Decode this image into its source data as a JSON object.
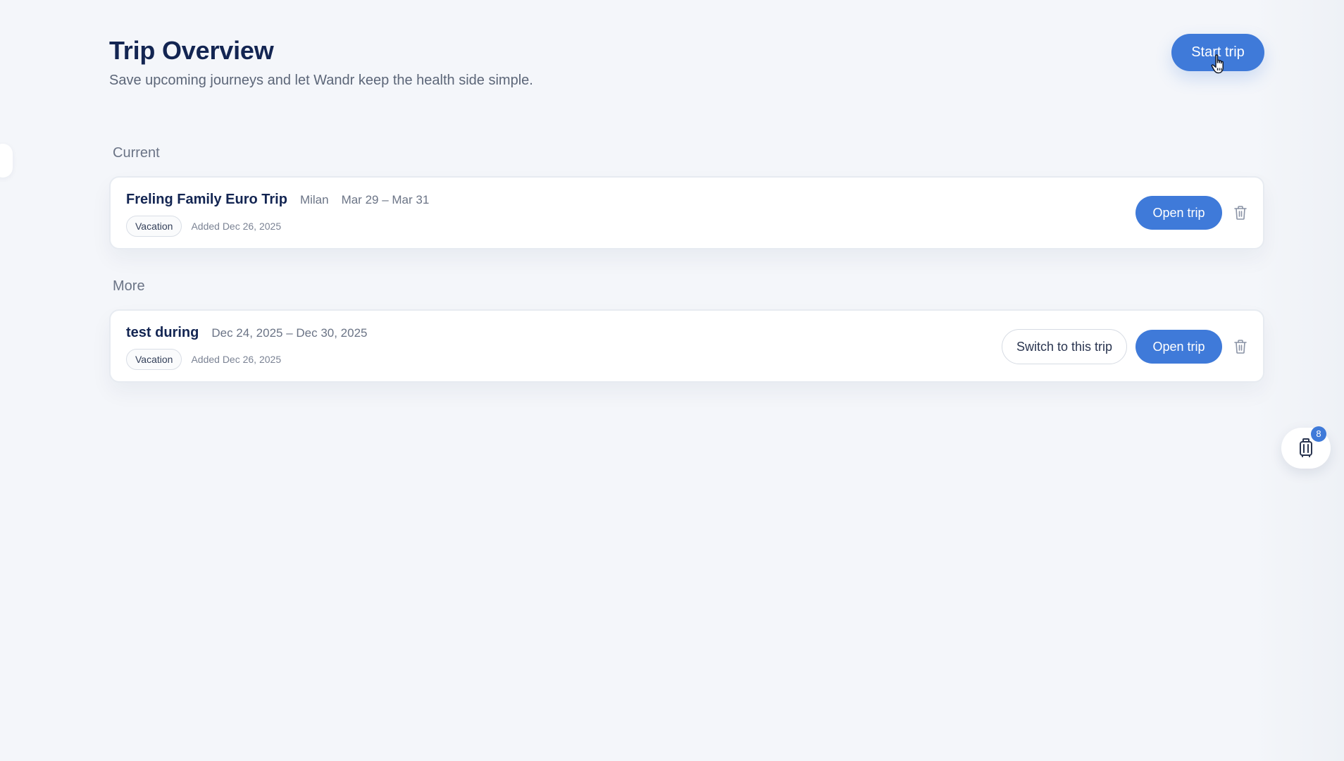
{
  "header": {
    "title": "Trip Overview",
    "subtitle": "Save upcoming journeys and let Wandr keep the health side simple.",
    "start_label": "Start trip"
  },
  "sections": {
    "current": {
      "label": "Current",
      "trip": {
        "name": "Freling Family Euro Trip",
        "location": "Milan",
        "dates": "Mar 29 – Mar 31",
        "tag": "Vacation",
        "added": "Added Dec 26, 2025",
        "open_label": "Open trip"
      }
    },
    "more": {
      "label": "More",
      "trip": {
        "name": "test during",
        "dates": "Dec 24, 2025 – Dec 30, 2025",
        "tag": "Vacation",
        "added": "Added Dec 26, 2025",
        "switch_label": "Switch to this trip",
        "open_label": "Open trip"
      }
    }
  },
  "floating": {
    "icon": "luggage-icon",
    "badge_count": "8"
  },
  "colors": {
    "accent": "#3f7ad9",
    "title": "#132552",
    "background": "#f3f5f9",
    "muted": "#6b7486"
  }
}
